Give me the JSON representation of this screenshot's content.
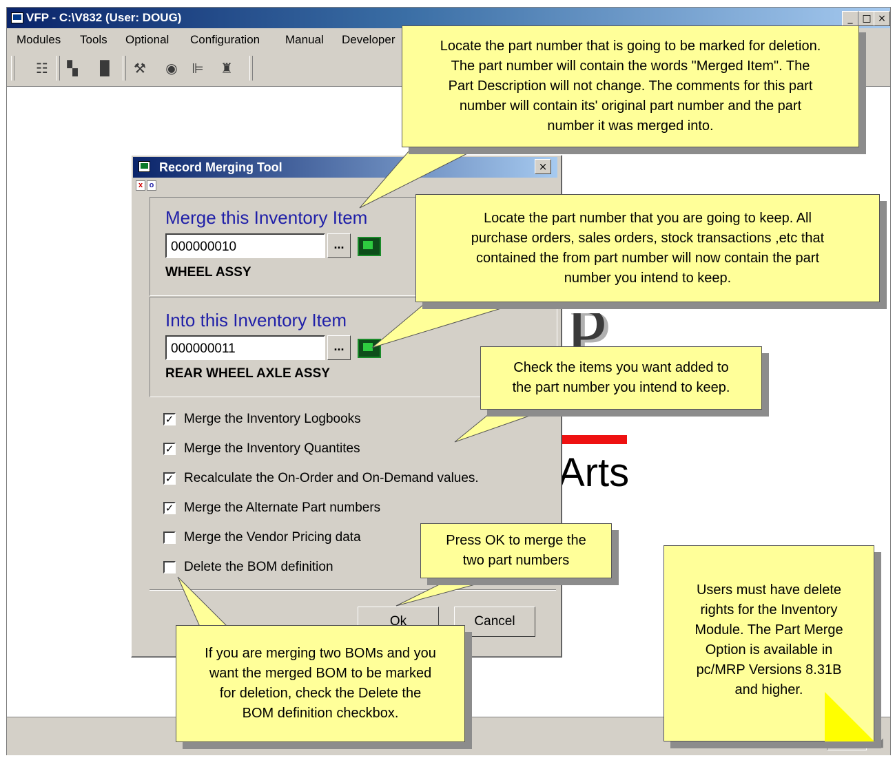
{
  "app": {
    "title": "VFP - C:\\V832  (User: DOUG)",
    "window_buttons": {
      "minimize": "_",
      "restore": "□",
      "close": "×"
    },
    "menu": [
      "Modules",
      "Tools",
      "Optional",
      "Configuration",
      "Manual",
      "Developer"
    ],
    "toolbar_icons": [
      "list-icon",
      "network-icon",
      "document-icon",
      "tools-icon",
      "globe-icon",
      "chart-icon",
      "people-icon"
    ]
  },
  "logo": {
    "fragment": "P",
    "word": "Arts",
    "colors": {
      "bar": "#ee1111"
    }
  },
  "dialog": {
    "title": "Record Merging Tool",
    "close_glyph": "×",
    "mini_buttons": [
      "x",
      "o"
    ],
    "merge_from": {
      "title": "Merge this Inventory Item",
      "part_number": "000000010",
      "browse_label": "...",
      "description": "WHEEL ASSY"
    },
    "merge_into": {
      "title": "Into this Inventory Item",
      "part_number": "000000011",
      "browse_label": "...",
      "description": "REAR WHEEL AXLE ASSY"
    },
    "options": [
      {
        "label": "Merge the Inventory Logbooks",
        "checked": true
      },
      {
        "label": "Merge the Inventory Quantites",
        "checked": true
      },
      {
        "label": "Recalculate the On-Order and On-Demand values.",
        "checked": true
      },
      {
        "label": "Merge the Alternate Part numbers",
        "checked": true
      },
      {
        "label": "Merge the Vendor Pricing data",
        "checked": false
      },
      {
        "label": "Delete the BOM definition",
        "checked": false
      }
    ],
    "ok_label": "Ok",
    "cancel_label": "Cancel"
  },
  "callouts": {
    "deletion": "Locate the part number that is going to be marked for deletion.\nThe part number will contain the words \"Merged Item\".  The\nPart Description will not change. The comments for this part\nnumber will contain its' original part number and the part\nnumber it was merged into.",
    "keep": "Locate the part number that you are going to keep. All\npurchase orders, sales orders, stock transactions ,etc that\ncontained the from part number will now contain the part\nnumber you intend to keep.",
    "check": "Check the items you want added to\nthe part number you intend to keep.",
    "ok": "Press OK to merge the\ntwo part numbers",
    "bom": "If you are merging two BOMs and you\nwant the merged BOM to be marked\nfor deletion, check the Delete the\nBOM definition checkbox.",
    "rights": "Users must have delete\nrights for the Inventory\nModule. The Part Merge\nOption is available in\npc/MRP Versions 8.31B\nand higher."
  }
}
